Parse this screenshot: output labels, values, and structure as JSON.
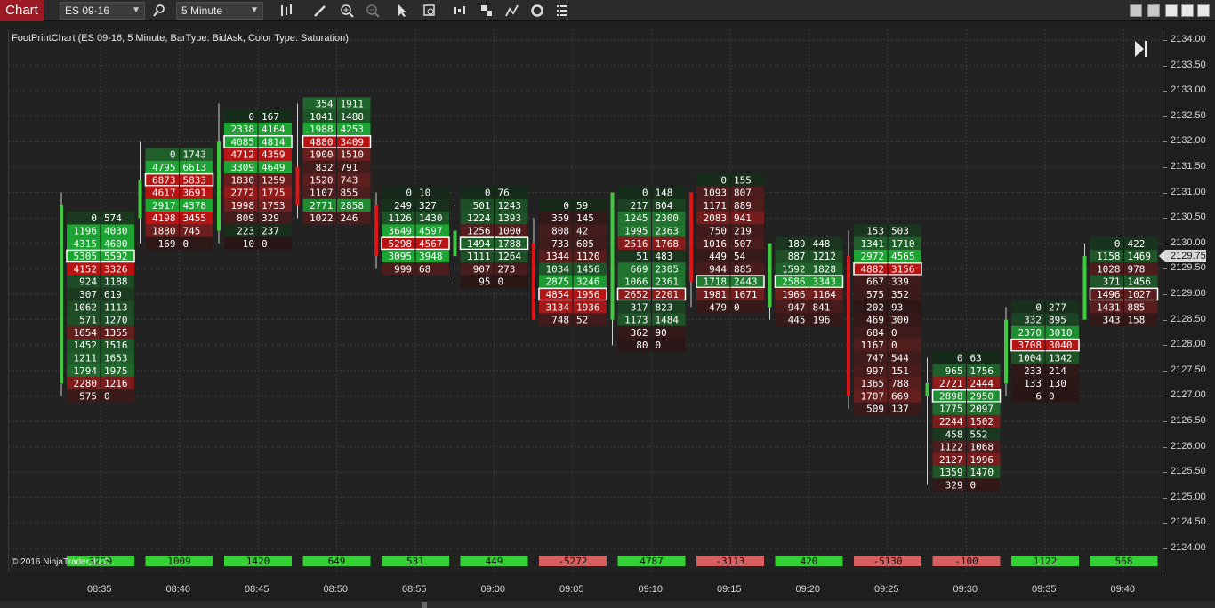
{
  "toolbar": {
    "tab_label": "Chart",
    "instrument": "ES 09-16",
    "interval": "5 Minute",
    "icons": [
      "search-icon",
      "bars-type-icon",
      "draw-pencil-icon",
      "zoom-in-icon",
      "zoom-out-icon",
      "pointer-icon",
      "data-box-icon",
      "bar-spacing-icon",
      "templates-icon",
      "strategies-icon",
      "reload-icon",
      "properties-icon"
    ]
  },
  "chart": {
    "title": "FootPrintChart (ES 09-16, 5 Minute, BarType: BidAsk, Color Type: Saturation)",
    "copyright": "© 2016 NinjaTrader, LLC",
    "last_price": "2129.75",
    "y_labels": [
      "2134.00",
      "2133.50",
      "2133.00",
      "2132.50",
      "2132.00",
      "2131.50",
      "2131.00",
      "2130.50",
      "2130.00",
      "2129.50",
      "2129.00",
      "2128.50",
      "2128.00",
      "2127.50",
      "2127.00",
      "2126.50",
      "2126.00",
      "2125.50",
      "2125.00",
      "2124.50",
      "2124.00"
    ]
  },
  "chart_data": {
    "type": "footprint",
    "price_tick": 0.25,
    "ylim": [
      2124.0,
      2134.0
    ],
    "bars": [
      {
        "time": "08:35",
        "open": 2127.25,
        "close": 2130.75,
        "high": 2131.0,
        "low": 2127.0,
        "delta": "3229",
        "rows": [
          [
            "0",
            "574"
          ],
          [
            "1196",
            "4030"
          ],
          [
            "4315",
            "4600"
          ],
          [
            "5305",
            "5592"
          ],
          [
            "4152",
            "3326"
          ],
          [
            "924",
            "1188"
          ],
          [
            "307",
            "619"
          ],
          [
            "1062",
            "1113"
          ],
          [
            "571",
            "1270"
          ],
          [
            "1654",
            "1355"
          ],
          [
            "1452",
            "1516"
          ],
          [
            "1211",
            "1653"
          ],
          [
            "1794",
            "1975"
          ],
          [
            "2280",
            "1216"
          ],
          [
            "575",
            "0"
          ]
        ]
      },
      {
        "time": "08:40",
        "open": 2130.5,
        "close": 2131.25,
        "high": 2132.0,
        "low": 2130.0,
        "delta": "1009",
        "rows": [
          [
            "0",
            "1743"
          ],
          [
            "4795",
            "6613"
          ],
          [
            "6873",
            "5833"
          ],
          [
            "4617",
            "3691"
          ],
          [
            "2917",
            "4378"
          ],
          [
            "4198",
            "3455"
          ],
          [
            "1880",
            "745"
          ],
          [
            "169",
            "0"
          ]
        ]
      },
      {
        "time": "08:45",
        "open": 2130.25,
        "close": 2132.0,
        "high": 2132.75,
        "low": 2130.0,
        "delta": "1420",
        "rows": [
          [
            "0",
            "167"
          ],
          [
            "2338",
            "4164"
          ],
          [
            "4085",
            "4814"
          ],
          [
            "4712",
            "4359"
          ],
          [
            "3309",
            "4649"
          ],
          [
            "1830",
            "1259"
          ],
          [
            "2772",
            "1775"
          ],
          [
            "1998",
            "1753"
          ],
          [
            "809",
            "329"
          ],
          [
            "223",
            "237"
          ],
          [
            "10",
            "0"
          ]
        ]
      },
      {
        "time": "08:50",
        "open": 2131.5,
        "close": 2130.75,
        "high": 2132.75,
        "low": 2130.5,
        "delta": "649",
        "rows": [
          [
            "354",
            "1911"
          ],
          [
            "1041",
            "1488"
          ],
          [
            "1988",
            "4253"
          ],
          [
            "4880",
            "3409"
          ],
          [
            "1900",
            "1510"
          ],
          [
            "832",
            "791"
          ],
          [
            "1520",
            "743"
          ],
          [
            "1107",
            "855"
          ],
          [
            "2771",
            "2858"
          ],
          [
            "1022",
            "246"
          ]
        ]
      },
      {
        "time": "08:55",
        "open": 2130.75,
        "close": 2129.75,
        "high": 2131.0,
        "low": 2129.5,
        "delta": "531",
        "rows": [
          [
            "0",
            "10"
          ],
          [
            "249",
            "327"
          ],
          [
            "1126",
            "1430"
          ],
          [
            "3649",
            "4597"
          ],
          [
            "5298",
            "4567"
          ],
          [
            "3095",
            "3948"
          ],
          [
            "999",
            "68"
          ]
        ]
      },
      {
        "time": "09:00",
        "open": 2129.75,
        "close": 2130.25,
        "high": 2130.75,
        "low": 2129.25,
        "delta": "449",
        "rows": [
          [
            "0",
            "76"
          ],
          [
            "501",
            "1243"
          ],
          [
            "1224",
            "1393"
          ],
          [
            "1256",
            "1000"
          ],
          [
            "1494",
            "1788"
          ],
          [
            "1111",
            "1264"
          ],
          [
            "907",
            "273"
          ],
          [
            "95",
            "0"
          ]
        ]
      },
      {
        "time": "09:05",
        "open": 2130.0,
        "close": 2128.5,
        "high": 2130.5,
        "low": 2128.5,
        "delta": "-5272",
        "rows": [
          [
            "0",
            "59"
          ],
          [
            "359",
            "145"
          ],
          [
            "808",
            "42"
          ],
          [
            "733",
            "605"
          ],
          [
            "1344",
            "1120"
          ],
          [
            "1034",
            "1456"
          ],
          [
            "2875",
            "3246"
          ],
          [
            "4854",
            "1956"
          ],
          [
            "3134",
            "1936"
          ],
          [
            "748",
            "52"
          ]
        ]
      },
      {
        "time": "09:10",
        "open": 2128.5,
        "close": 2131.0,
        "high": 2131.0,
        "low": 2128.0,
        "delta": "4787",
        "rows": [
          [
            "0",
            "148"
          ],
          [
            "217",
            "804"
          ],
          [
            "1245",
            "2300"
          ],
          [
            "1995",
            "2363"
          ],
          [
            "2516",
            "1768"
          ],
          [
            "51",
            "483"
          ],
          [
            "669",
            "2305"
          ],
          [
            "1066",
            "2361"
          ],
          [
            "2652",
            "2201"
          ],
          [
            "317",
            "823"
          ],
          [
            "1173",
            "1484"
          ],
          [
            "362",
            "90"
          ],
          [
            "80",
            "0"
          ]
        ]
      },
      {
        "time": "09:15",
        "open": 2131.0,
        "close": 2129.25,
        "high": 2131.0,
        "low": 2128.75,
        "delta": "-3113",
        "rows": [
          [
            "0",
            "155"
          ],
          [
            "1093",
            "807"
          ],
          [
            "1171",
            "889"
          ],
          [
            "2083",
            "941"
          ],
          [
            "750",
            "219"
          ],
          [
            "1016",
            "507"
          ],
          [
            "449",
            "54"
          ],
          [
            "944",
            "885"
          ],
          [
            "1718",
            "2443"
          ],
          [
            "1981",
            "1671"
          ],
          [
            "479",
            "0"
          ]
        ]
      },
      {
        "time": "09:20",
        "open": 2128.75,
        "close": 2130.0,
        "high": 2130.0,
        "low": 2128.5,
        "delta": "420",
        "rows": [
          [
            "189",
            "448"
          ],
          [
            "887",
            "1212"
          ],
          [
            "1592",
            "1828"
          ],
          [
            "2586",
            "3343"
          ],
          [
            "1966",
            "1164"
          ],
          [
            "947",
            "841"
          ],
          [
            "445",
            "196"
          ]
        ]
      },
      {
        "time": "09:25",
        "open": 2129.75,
        "close": 2127.0,
        "high": 2130.25,
        "low": 2126.75,
        "delta": "-5130",
        "rows": [
          [
            "153",
            "503"
          ],
          [
            "1341",
            "1710"
          ],
          [
            "2972",
            "4565"
          ],
          [
            "4882",
            "3156"
          ],
          [
            "667",
            "339"
          ],
          [
            "575",
            "352"
          ],
          [
            "202",
            "93"
          ],
          [
            "469",
            "300"
          ],
          [
            "684",
            "0"
          ],
          [
            "1167",
            "0"
          ],
          [
            "747",
            "544"
          ],
          [
            "997",
            "151"
          ],
          [
            "1365",
            "788"
          ],
          [
            "1707",
            "669"
          ],
          [
            "509",
            "137"
          ]
        ]
      },
      {
        "time": "09:30",
        "open": 2127.0,
        "close": 2127.25,
        "high": 2127.75,
        "low": 2125.25,
        "delta": "-100",
        "rows": [
          [
            "0",
            "63"
          ],
          [
            "965",
            "1756"
          ],
          [
            "2721",
            "2444"
          ],
          [
            "2898",
            "2950"
          ],
          [
            "1775",
            "2097"
          ],
          [
            "2244",
            "1502"
          ],
          [
            "458",
            "552"
          ],
          [
            "1122",
            "1068"
          ],
          [
            "2127",
            "1996"
          ],
          [
            "1359",
            "1470"
          ],
          [
            "329",
            "0"
          ]
        ]
      },
      {
        "time": "09:35",
        "open": 2127.25,
        "close": 2128.5,
        "high": 2128.75,
        "low": 2127.0,
        "delta": "1122",
        "rows": [
          [
            "0",
            "277"
          ],
          [
            "332",
            "895"
          ],
          [
            "2370",
            "3010"
          ],
          [
            "3708",
            "3040"
          ],
          [
            "1004",
            "1342"
          ],
          [
            "233",
            "214"
          ],
          [
            "133",
            "130"
          ],
          [
            "6",
            "0"
          ]
        ]
      },
      {
        "time": "09:40",
        "open": 2128.5,
        "close": 2129.75,
        "high": 2130.0,
        "low": 2128.5,
        "delta": "568",
        "rows": [
          [
            "0",
            "422"
          ],
          [
            "1158",
            "1469"
          ],
          [
            "1028",
            "978"
          ],
          [
            "371",
            "1456"
          ],
          [
            "1496",
            "1027"
          ],
          [
            "1431",
            "885"
          ],
          [
            "343",
            "158"
          ]
        ]
      }
    ]
  }
}
